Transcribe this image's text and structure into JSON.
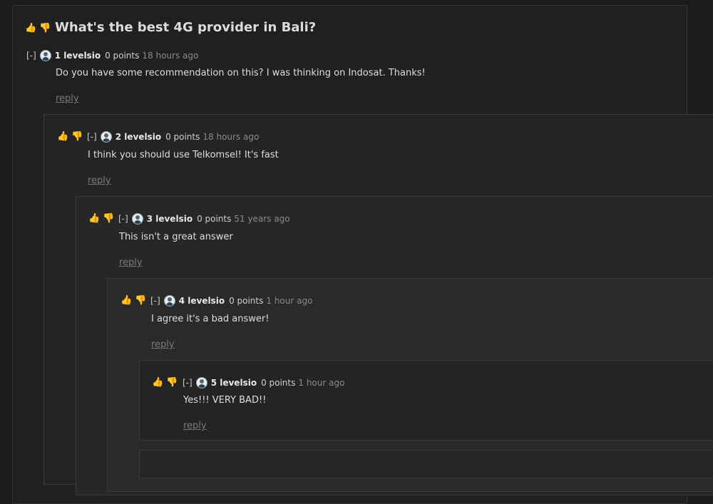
{
  "post": {
    "title": "What's the best 4G provider in Bali?"
  },
  "vote": {
    "up": "👍",
    "down": "👎"
  },
  "comments": [
    {
      "toggle": "[-]",
      "user": "1 levelsio",
      "points": "0 points",
      "time": "18 hours ago",
      "text": "Do you have some recommendation on this? I was thinking on Indosat. Thanks!",
      "reply": "reply"
    },
    {
      "toggle": "[-]",
      "user": "2 levelsio",
      "points": "0 points",
      "time": "18 hours ago",
      "text": "I think you should use Telkomsel! It's fast",
      "reply": "reply"
    },
    {
      "toggle": "[-]",
      "user": "3 levelsio",
      "points": "0 points",
      "time": "51 years ago",
      "text": "This isn't a great answer",
      "reply": "reply"
    },
    {
      "toggle": "[-]",
      "user": "4 levelsio",
      "points": "0 points",
      "time": "1 hour ago",
      "text": "I agree it's a bad answer!",
      "reply": "reply"
    },
    {
      "toggle": "[-]",
      "user": "5 levelsio",
      "points": "0 points",
      "time": "1 hour ago",
      "text": "Yes!!! VERY BAD!!",
      "reply": "reply"
    }
  ]
}
